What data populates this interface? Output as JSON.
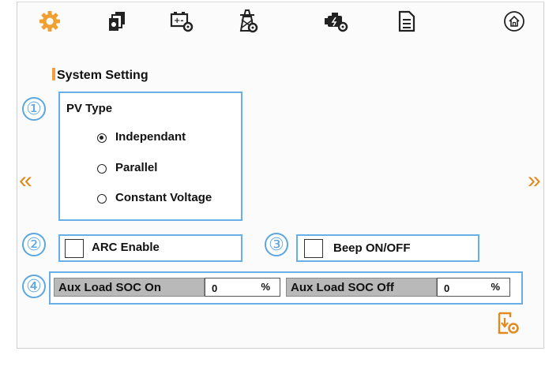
{
  "toolbar": {
    "items": [
      {
        "icon": "gear-icon",
        "color": "#f0a030"
      },
      {
        "icon": "stacked-pages-icon"
      },
      {
        "icon": "battery-settings-icon"
      },
      {
        "icon": "grid-tower-settings-icon"
      },
      {
        "icon": "generator-settings-icon"
      },
      {
        "icon": "document-icon"
      },
      {
        "icon": "home-icon"
      }
    ]
  },
  "section_title": "System Setting",
  "badges": [
    "①",
    "②",
    "③",
    "④"
  ],
  "pv_type": {
    "label": "PV Type",
    "options": [
      {
        "label": "Independant",
        "selected": true
      },
      {
        "label": "Parallel",
        "selected": false
      },
      {
        "label": "Constant Voltage",
        "selected": false
      }
    ]
  },
  "arc_enable": {
    "label": "ARC Enable",
    "checked": false
  },
  "beep": {
    "label": "Beep ON/OFF",
    "checked": false
  },
  "aux_load": {
    "on_label": "Aux Load SOC On",
    "on_value": "0",
    "on_unit": "%",
    "off_label": "Aux Load SOC Off",
    "off_value": "0",
    "off_unit": "%"
  },
  "nav": {
    "prev": "«",
    "next": "»"
  },
  "colors": {
    "accent": "#f0a030",
    "frame_blue": "#6aaee6",
    "badge_blue": "#5ea6e0",
    "label_grey": "#b9b9b9"
  }
}
